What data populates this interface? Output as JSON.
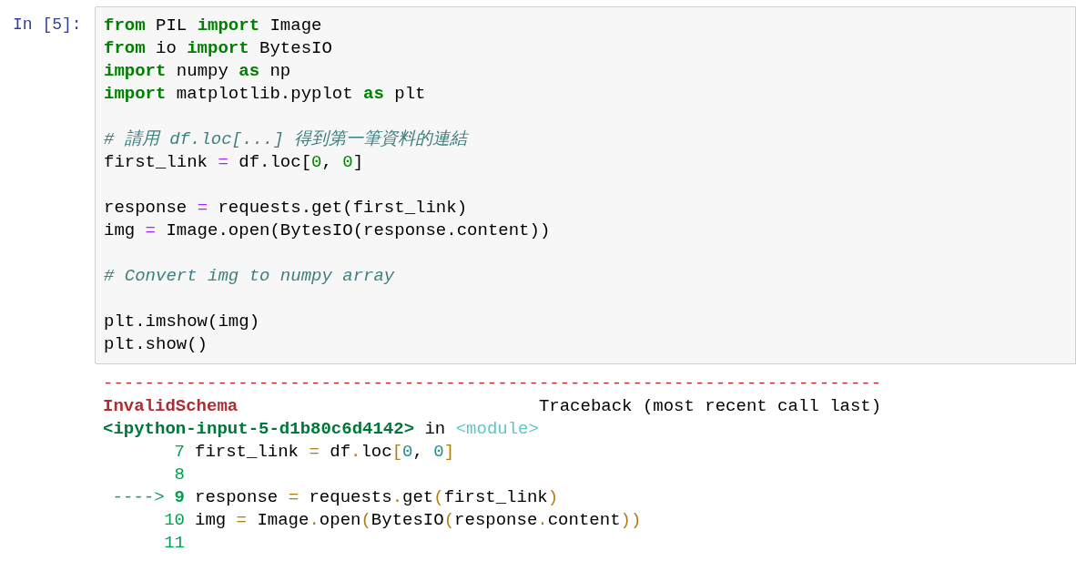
{
  "cell": {
    "prompt": "In [5]:",
    "code_lines": [
      {
        "kind": "code",
        "tokens": [
          {
            "text": "from",
            "kind": "kw"
          },
          {
            "text": " PIL ",
            "kind": "plain"
          },
          {
            "text": "import",
            "kind": "kw"
          },
          {
            "text": " Image",
            "kind": "plain"
          }
        ]
      },
      {
        "kind": "code",
        "tokens": [
          {
            "text": "from",
            "kind": "kw"
          },
          {
            "text": " io ",
            "kind": "plain"
          },
          {
            "text": "import",
            "kind": "kw"
          },
          {
            "text": " BytesIO",
            "kind": "plain"
          }
        ]
      },
      {
        "kind": "code",
        "tokens": [
          {
            "text": "import",
            "kind": "kw"
          },
          {
            "text": " numpy ",
            "kind": "plain"
          },
          {
            "text": "as",
            "kind": "kw"
          },
          {
            "text": " np",
            "kind": "plain"
          }
        ]
      },
      {
        "kind": "code",
        "tokens": [
          {
            "text": "import",
            "kind": "kw"
          },
          {
            "text": " matplotlib.pyplot ",
            "kind": "plain"
          },
          {
            "text": "as",
            "kind": "kw"
          },
          {
            "text": " plt",
            "kind": "plain"
          }
        ]
      },
      {
        "kind": "blank"
      },
      {
        "kind": "code",
        "tokens": [
          {
            "text": "# 請用 df.loc[...] 得到第一筆資料的連結",
            "kind": "comment"
          }
        ]
      },
      {
        "kind": "code",
        "tokens": [
          {
            "text": "first_link ",
            "kind": "plain"
          },
          {
            "text": "=",
            "kind": "op"
          },
          {
            "text": " df.loc[",
            "kind": "plain"
          },
          {
            "text": "0",
            "kind": "num"
          },
          {
            "text": ", ",
            "kind": "plain"
          },
          {
            "text": "0",
            "kind": "num"
          },
          {
            "text": "]",
            "kind": "plain"
          }
        ]
      },
      {
        "kind": "blank"
      },
      {
        "kind": "code",
        "tokens": [
          {
            "text": "response ",
            "kind": "plain"
          },
          {
            "text": "=",
            "kind": "op"
          },
          {
            "text": " requests.get(first_link)",
            "kind": "plain"
          }
        ]
      },
      {
        "kind": "code",
        "tokens": [
          {
            "text": "img ",
            "kind": "plain"
          },
          {
            "text": "=",
            "kind": "op"
          },
          {
            "text": " Image.open(BytesIO(response.content))",
            "kind": "plain"
          }
        ]
      },
      {
        "kind": "blank"
      },
      {
        "kind": "code",
        "tokens": [
          {
            "text": "# Convert img to numpy array",
            "kind": "comment"
          }
        ]
      },
      {
        "kind": "blank"
      },
      {
        "kind": "code",
        "tokens": [
          {
            "text": "plt.imshow(img)",
            "kind": "plain"
          }
        ]
      },
      {
        "kind": "code",
        "tokens": [
          {
            "text": "plt.show()",
            "kind": "plain"
          }
        ]
      }
    ]
  },
  "traceback": {
    "rule": "---------------------------------------------------------------------------",
    "error_name": "InvalidSchema",
    "header": "Traceback (most recent call last)",
    "location": [
      {
        "text": "<ipython-input-5-d1b80c6d4142>",
        "kind": "loc"
      },
      {
        "text": " in ",
        "kind": "plain"
      },
      {
        "text": "<module>",
        "kind": "mod"
      }
    ],
    "lines": [
      {
        "number": "7",
        "current": false,
        "tokens": [
          {
            "text": "first_link ",
            "kind": "plain"
          },
          {
            "text": "=",
            "kind": "tbop"
          },
          {
            "text": " df",
            "kind": "plain"
          },
          {
            "text": ".",
            "kind": "tbop"
          },
          {
            "text": "loc",
            "kind": "plain"
          },
          {
            "text": "[",
            "kind": "tbop"
          },
          {
            "text": "0",
            "kind": "tbnum"
          },
          {
            "text": ", ",
            "kind": "plain"
          },
          {
            "text": "0",
            "kind": "tbnum"
          },
          {
            "text": "]",
            "kind": "tbop"
          }
        ]
      },
      {
        "number": "8",
        "current": false
      },
      {
        "marker": "---->",
        "number": "9",
        "current": true,
        "tokens": [
          {
            "text": "response ",
            "kind": "plain"
          },
          {
            "text": "=",
            "kind": "tbop"
          },
          {
            "text": " requests",
            "kind": "plain"
          },
          {
            "text": ".",
            "kind": "tbop"
          },
          {
            "text": "get",
            "kind": "plain"
          },
          {
            "text": "(",
            "kind": "tbop"
          },
          {
            "text": "first_link",
            "kind": "plain"
          },
          {
            "text": ")",
            "kind": "tbop"
          }
        ]
      },
      {
        "number": "10",
        "current": false,
        "tokens": [
          {
            "text": "img ",
            "kind": "plain"
          },
          {
            "text": "=",
            "kind": "tbop"
          },
          {
            "text": " Image",
            "kind": "plain"
          },
          {
            "text": ".",
            "kind": "tbop"
          },
          {
            "text": "open",
            "kind": "plain"
          },
          {
            "text": "(",
            "kind": "tbop"
          },
          {
            "text": "BytesIO",
            "kind": "plain"
          },
          {
            "text": "(",
            "kind": "tbop"
          },
          {
            "text": "response",
            "kind": "plain"
          },
          {
            "text": ".",
            "kind": "tbop"
          },
          {
            "text": "content",
            "kind": "plain"
          },
          {
            "text": "))",
            "kind": "tbop"
          }
        ]
      },
      {
        "number": "11",
        "current": false
      }
    ]
  }
}
